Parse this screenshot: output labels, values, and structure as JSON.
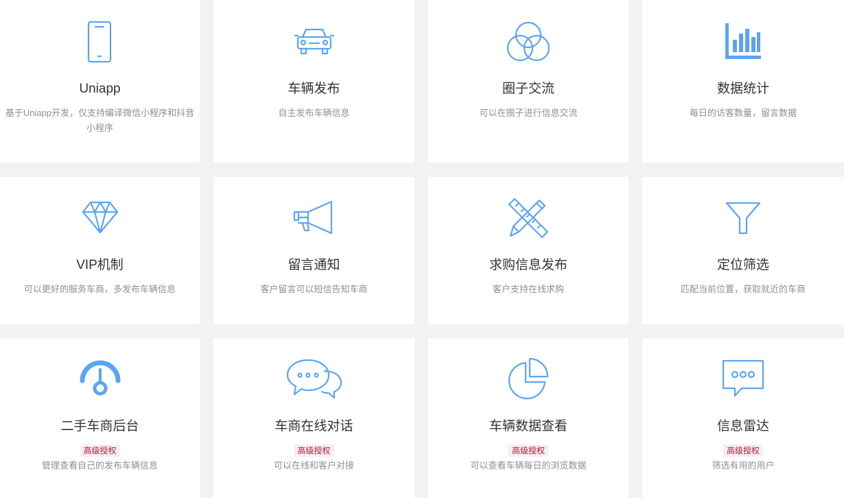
{
  "colors": {
    "accent": "#5aa4f5",
    "badge_text": "#b5173b",
    "badge_bg": "#f7eef0"
  },
  "features": [
    {
      "icon": "smartphone-icon",
      "title": "Uniapp",
      "desc": "基于Uniapp开发，仅支持编译微信小程序和抖音小程序"
    },
    {
      "icon": "car-icon",
      "title": "车辆发布",
      "desc": "自主发布车辆信息"
    },
    {
      "icon": "circles-icon",
      "title": "圈子交流",
      "desc": "可以在圈子进行信息交流"
    },
    {
      "icon": "bar-chart-icon",
      "title": "数据统计",
      "desc": "每日的访客数量，留言数据"
    },
    {
      "icon": "diamond-icon",
      "title": "VIP机制",
      "desc": "可以更好的服务车商，多发布车辆信息"
    },
    {
      "icon": "megaphone-icon",
      "title": "留言通知",
      "desc": "客户留言可以短信告知车商"
    },
    {
      "icon": "pencil-ruler-icon",
      "title": "求购信息发布",
      "desc": "客户支持在线求购"
    },
    {
      "icon": "funnel-icon",
      "title": "定位筛选",
      "desc": "匹配当前位置，获取就近的车商"
    },
    {
      "icon": "dashboard-gauge-icon",
      "title": "二手车商后台",
      "badge": "高级授权",
      "desc": "管理查看自己的发布车辆信息"
    },
    {
      "icon": "chat-bubbles-icon",
      "title": "车商在线对话",
      "badge": "高级授权",
      "desc": "可以在线和客户对接"
    },
    {
      "icon": "pie-chart-icon",
      "title": "车辆数据查看",
      "badge": "高级授权",
      "desc": "可以查看车辆每日的浏览数据"
    },
    {
      "icon": "message-dots-icon",
      "title": "信息雷达",
      "badge": "高级授权",
      "desc": "筛选有用的用户"
    }
  ]
}
